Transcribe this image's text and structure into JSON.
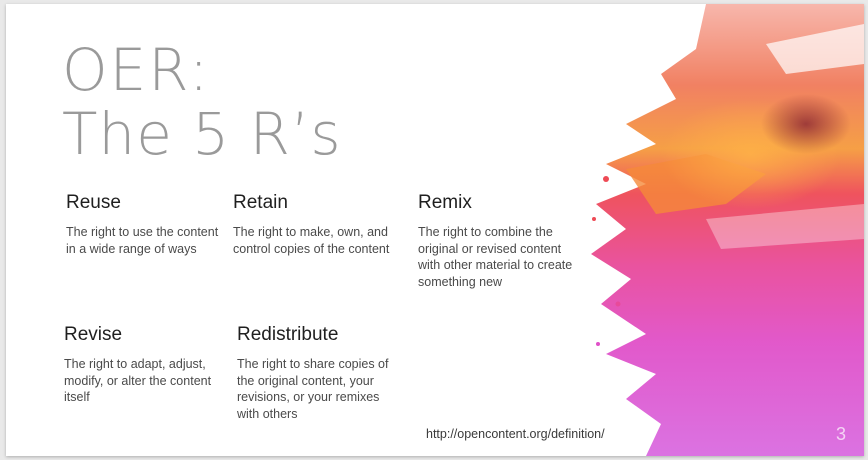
{
  "slide": {
    "title_line1": "OER:",
    "title_line2": "The 5 R’s",
    "items": [
      {
        "heading": "Reuse",
        "text": "The right to use the content in a wide range of ways"
      },
      {
        "heading": "Retain",
        "text": "The right to make, own, and control copies of the content"
      },
      {
        "heading": "Remix",
        "text": "The right to combine the original or revised content with other material to create something new"
      },
      {
        "heading": "Revise",
        "text": "The right to adapt, adjust, modify, or alter the content itself"
      },
      {
        "heading": "Redistribute",
        "text": "The right to share copies of the original content, your revisions, or your remixes with others"
      }
    ],
    "url": "http://opencontent.org/definition/",
    "page_number": "3"
  }
}
